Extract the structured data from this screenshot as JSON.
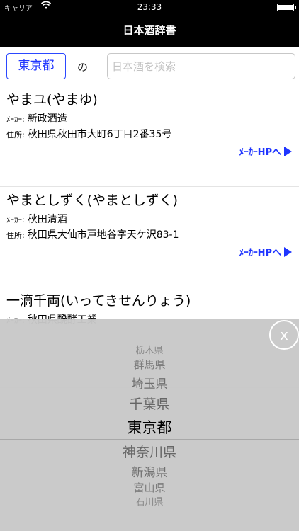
{
  "status_bar": {
    "carrier": "キャリア",
    "time": "23:33"
  },
  "header": {
    "title": "日本酒辞書"
  },
  "search": {
    "prefecture": "東京都",
    "connector": "の",
    "placeholder": "日本酒を検索",
    "value": ""
  },
  "labels": {
    "maker": "ﾒｰｶｰ:",
    "address": "住所:",
    "link": "ﾒｰｶｰHPへ"
  },
  "results": [
    {
      "name": "やまユ(やまゆ)",
      "maker": "新政酒造",
      "address": "秋田県秋田市大町6丁目2番35号"
    },
    {
      "name": "やまとしずく(やまとしずく)",
      "maker": "秋田清酒",
      "address": "秋田県大仙市戸地谷字天ケ沢83-1"
    },
    {
      "name": "一滴千両(いってきせんりょう)",
      "maker": "秋田県醗酵工業",
      "address": ""
    }
  ],
  "picker": {
    "close_label": "x",
    "options": [
      "栃木県",
      "群馬県",
      "埼玉県",
      "千葉県",
      "東京都",
      "神奈川県",
      "新潟県",
      "富山県",
      "石川県"
    ],
    "selected": "東京都"
  }
}
